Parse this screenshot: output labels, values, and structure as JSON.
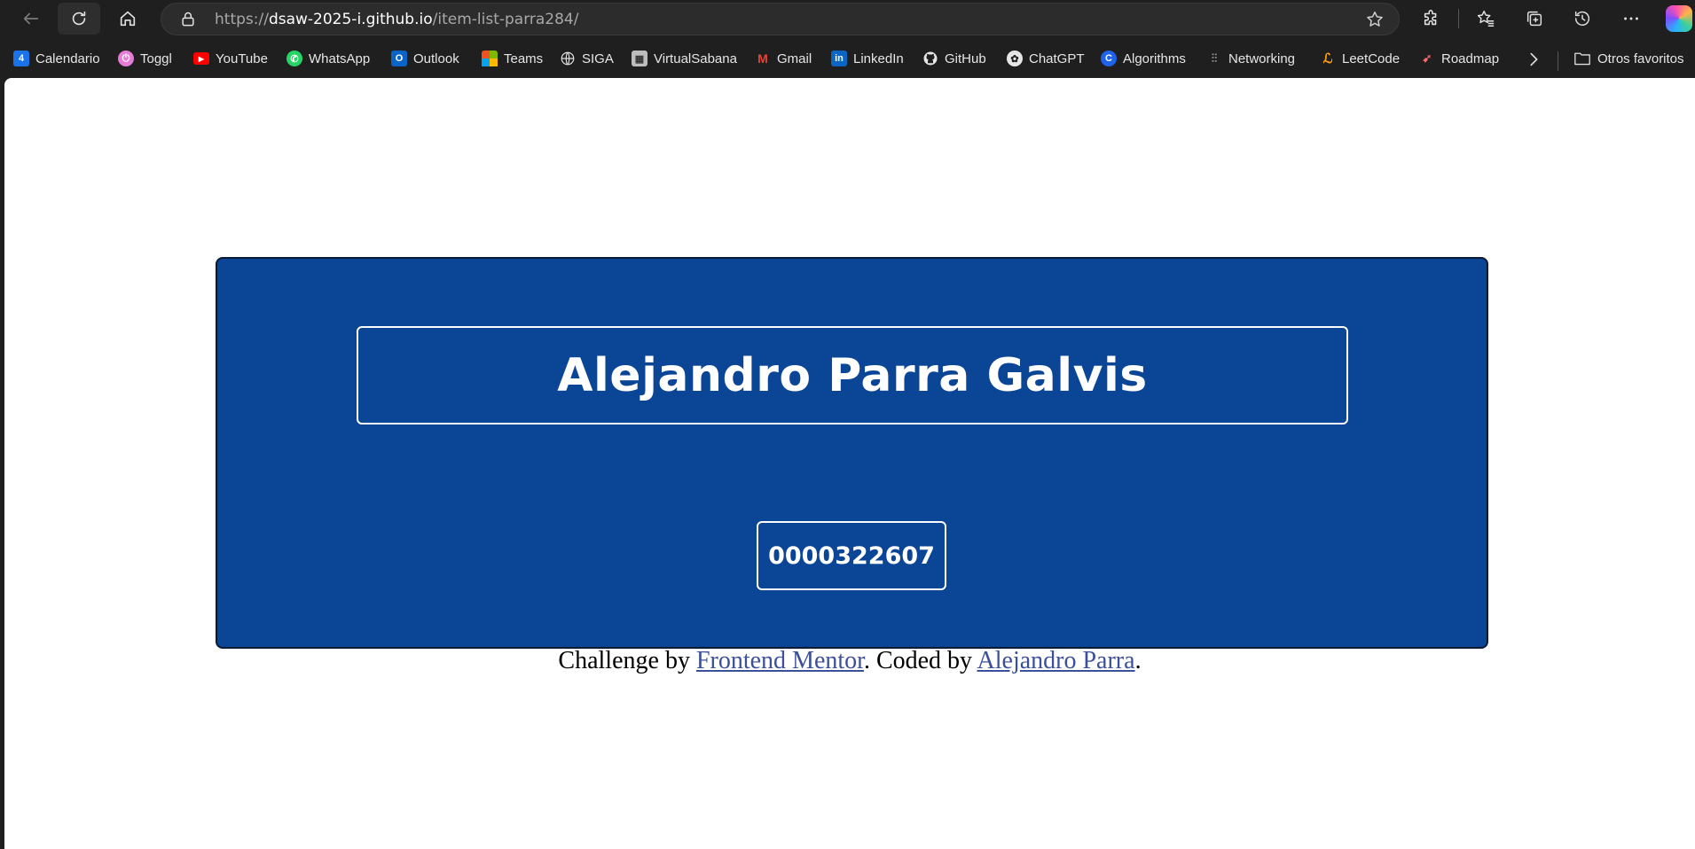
{
  "browser": {
    "url_scheme": "https://",
    "url_host": "dsaw-2025-i.github.io",
    "url_path": "/item-list-parra284/"
  },
  "bookmarks": [
    {
      "label": "Calendario",
      "icon": "calendar-icon",
      "color": "#1a73e8",
      "glyph": "4"
    },
    {
      "label": "Toggl",
      "icon": "toggl-icon",
      "color": "#e57cd8",
      "glyph": "⏻"
    },
    {
      "label": "YouTube",
      "icon": "youtube-icon",
      "color": "#ff0000",
      "glyph": "▶"
    },
    {
      "label": "WhatsApp",
      "icon": "whatsapp-icon",
      "color": "#25d366",
      "glyph": "✆"
    },
    {
      "label": "Outlook",
      "icon": "outlook-icon",
      "color": "#0a64c8",
      "glyph": "O"
    },
    {
      "label": "Teams",
      "icon": "microsoft-icon",
      "color": "#f25022",
      "glyph": ""
    },
    {
      "label": "SIGA",
      "icon": "globe-icon",
      "color": "#1f1f1f",
      "glyph": "🌐"
    },
    {
      "label": "VirtualSabana",
      "icon": "virtualsabana-icon",
      "color": "#9e9e9e",
      "glyph": "▦"
    },
    {
      "label": "Gmail",
      "icon": "gmail-icon",
      "color": "#1f1f1f",
      "glyph": "M"
    },
    {
      "label": "LinkedIn",
      "icon": "linkedin-icon",
      "color": "#0a66c2",
      "glyph": "in"
    },
    {
      "label": "GitHub",
      "icon": "github-icon",
      "color": "#1f1f1f",
      "glyph": "●"
    },
    {
      "label": "ChatGPT",
      "icon": "chatgpt-icon",
      "color": "#1f1f1f",
      "glyph": "✿"
    },
    {
      "label": "Algorithms",
      "icon": "algorithms-icon",
      "color": "#1e63e9",
      "glyph": "C"
    },
    {
      "label": "Networking",
      "icon": "cisco-icon",
      "color": "#1f1f1f",
      "glyph": "⫶"
    },
    {
      "label": "LeetCode",
      "icon": "leetcode-icon",
      "color": "#1f1f1f",
      "glyph": "ℒ"
    },
    {
      "label": "Roadmap",
      "icon": "rocket-icon",
      "color": "#1f1f1f",
      "glyph": "🚀"
    }
  ],
  "other_favorites": "Otros favoritos",
  "page": {
    "name": "Alejandro Parra Galvis",
    "id_number": "0000322607",
    "attribution_prefix": "Challenge by ",
    "link_frontend": "Frontend Mentor",
    "attribution_middle": ". Coded by ",
    "link_author": "Alejandro Parra",
    "attribution_suffix": "."
  },
  "colors": {
    "card_background": "#0b4595",
    "link": "#3b4f9b"
  }
}
